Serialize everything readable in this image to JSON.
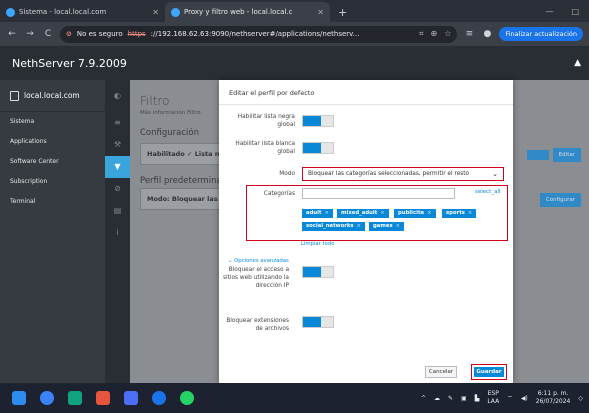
{
  "browser": {
    "tabs": [
      {
        "title": "Sistema - local.local.com",
        "close": "✕"
      },
      {
        "title": "Proxy y filtro web - local.local.c",
        "close": "✕"
      }
    ],
    "new_tab": "+",
    "window_controls": [
      "—",
      "□"
    ],
    "nav": {
      "back": "←",
      "forward": "→",
      "reload": "C"
    },
    "security_label": "No es seguro",
    "url_https": "https",
    "url_rest": "://192.168.62.63:9090/nethserver#/applications/nethserv...",
    "update_button": "Finalizar actualización"
  },
  "app": {
    "title": "NethServer 7.9.2009",
    "host": "local.local.com",
    "nav_items": [
      "Sistema",
      "Applications",
      "Software Center",
      "Subscription",
      "Terminal"
    ],
    "page_title": "Filtro",
    "page_subtitle": "Más información Filtro",
    "section_config": "Configuración",
    "enabled_text": "Habilitado ✓ Lista n",
    "section_profile": "Perfil predeterminado",
    "mode_text": "Modo: Bloquear las ca",
    "edit_button": "Editar",
    "configure_button": "Configurar"
  },
  "modal": {
    "title": "Editar el perfil por defecto",
    "global_blacklist_label": "Habilitar lista negra global",
    "global_whitelist_label": "Habilitar lista blanca global",
    "mode_label": "Modo",
    "mode_value": "Bloquear las categorías seleccionadas, permitir el resto",
    "categories_label": "Categorías",
    "select_all": "select_all",
    "categories": [
      "adult",
      "mixed_adult",
      "publicite",
      "sports",
      "social_networks",
      "games"
    ],
    "chip_close": "×",
    "clear_all": "Limpiar todo",
    "advanced": "Opciones avanzadas",
    "block_ip_label": "Bloquear el acceso a sitios web utilizando la dirección IP",
    "block_ext_label": "Bloquear extensiones de archivos",
    "cancel": "Cancelar",
    "save": "Guardar",
    "toggle_color": "#0a88d8",
    "highlight_color": "#d0021b"
  },
  "taskbar": {
    "lang_top": "ESP",
    "lang_bottom": "LAA",
    "time": "6:11 p. m.",
    "date": "26/07/2024"
  }
}
